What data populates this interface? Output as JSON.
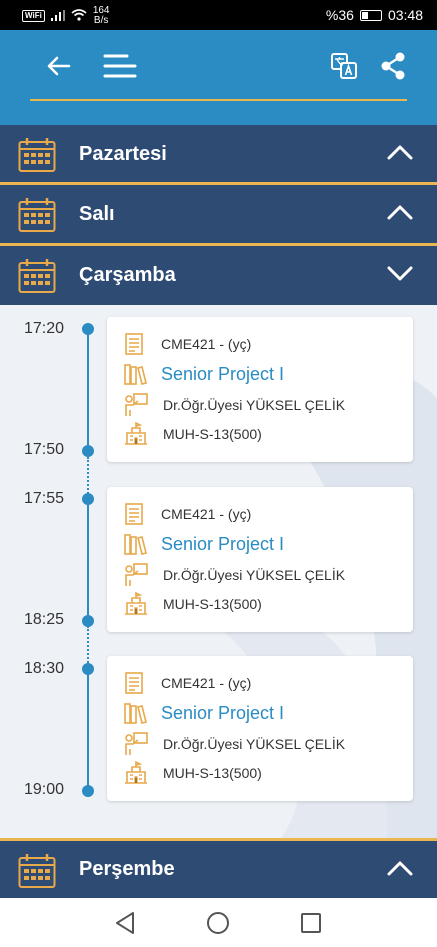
{
  "status_bar": {
    "wifi_badge": "WiFi",
    "speed_value": "164",
    "speed_unit": "B/s",
    "battery": "%36",
    "time": "03:48"
  },
  "days": [
    {
      "name": "Pazartesi",
      "expanded": false
    },
    {
      "name": "Salı",
      "expanded": false
    },
    {
      "name": "Çarşamba",
      "expanded": true
    },
    {
      "name": "Perşembe",
      "expanded": false
    }
  ],
  "lessons": [
    {
      "start": "17:20",
      "end": "17:50",
      "code": "CME421 - (yç)",
      "title": "Senior Project I",
      "instructor": "Dr.Öğr.Üyesi YÜKSEL ÇELİK",
      "room": "MUH-S-13(500)"
    },
    {
      "start": "17:55",
      "end": "18:25",
      "code": "CME421 - (yç)",
      "title": "Senior Project I",
      "instructor": "Dr.Öğr.Üyesi YÜKSEL ÇELİK",
      "room": "MUH-S-13(500)"
    },
    {
      "start": "18:30",
      "end": "19:00",
      "code": "CME421 - (yç)",
      "title": "Senior Project I",
      "instructor": "Dr.Öğr.Üyesi YÜKSEL ÇELİK",
      "room": "MUH-S-13(500)"
    }
  ],
  "colors": {
    "header_blue": "#2a8cc3",
    "day_navy": "#2e4b74",
    "accent_gold": "#e9b64f",
    "icon_orange": "#e8a94a"
  }
}
